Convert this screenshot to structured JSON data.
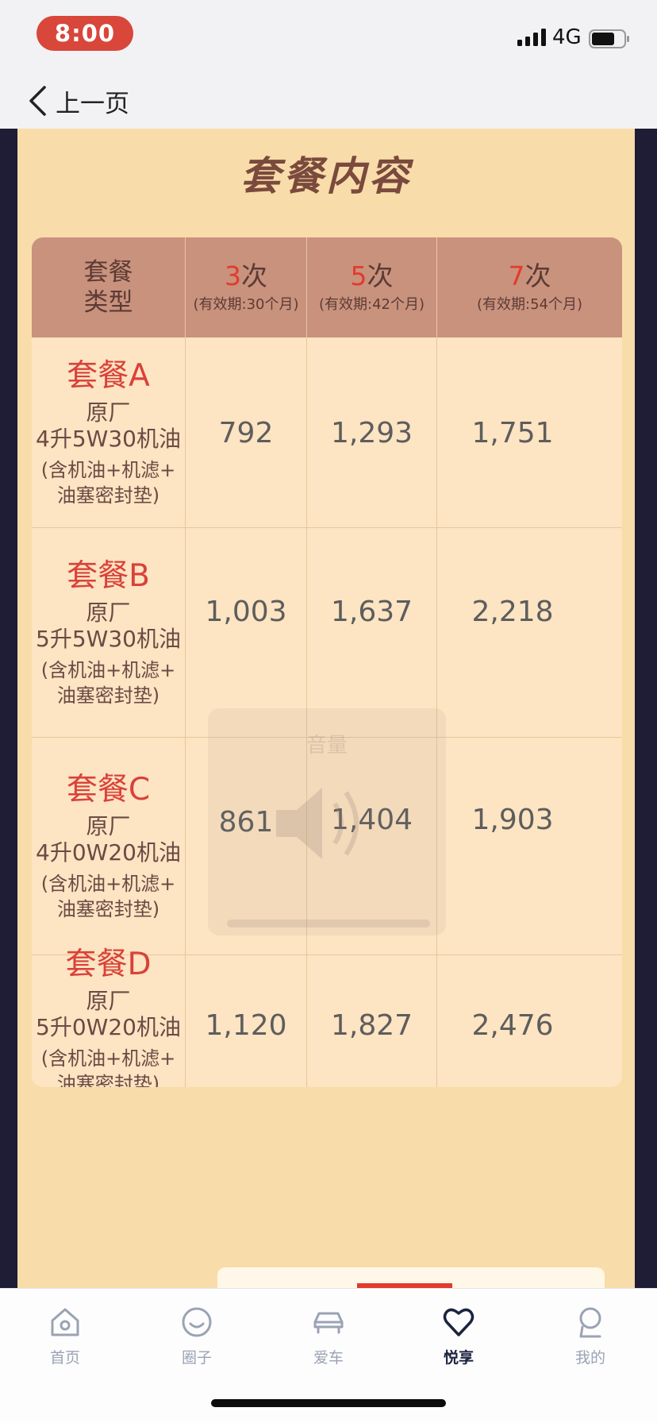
{
  "status_bar": {
    "time": "8:00",
    "network": "4G"
  },
  "nav": {
    "back_label": "上一页"
  },
  "section": {
    "title": "套餐内容"
  },
  "table": {
    "type_header": [
      "套餐",
      "类型"
    ],
    "columns": [
      {
        "count": "3",
        "unit": "次",
        "validity": "(有效期:30个月)"
      },
      {
        "count": "5",
        "unit": "次",
        "validity": "(有效期:42个月)"
      },
      {
        "count": "7",
        "unit": "次",
        "validity": "(有效期:54个月)"
      }
    ],
    "rows": [
      {
        "name": "套餐A",
        "origin": "原厂",
        "oil": "4升5W30机油",
        "note1": "(含机油+机滤+",
        "note2": "油塞密封垫)",
        "prices": [
          "792",
          "1,293",
          "1,751"
        ]
      },
      {
        "name": "套餐B",
        "origin": "原厂",
        "oil": "5升5W30机油",
        "note1": "(含机油+机滤+",
        "note2": "油塞密封垫)",
        "prices": [
          "1,003",
          "1,637",
          "2,218"
        ]
      },
      {
        "name": "套餐C",
        "origin": "原厂",
        "oil": "4升0W20机油",
        "note1": "(含机油+机滤+",
        "note2": "油塞密封垫)",
        "prices": [
          "861",
          "1,404",
          "1,903"
        ]
      },
      {
        "name": "套餐D",
        "origin": "原厂",
        "oil": "5升0W20机油",
        "note1": "(含机油+机滤+",
        "note2": "油塞密封垫)",
        "prices": [
          "1,120",
          "1,827",
          "2,476"
        ]
      }
    ]
  },
  "volume_overlay": {
    "title": "音量",
    "icon": "speaker-icon"
  },
  "tabs": [
    {
      "label": "首页",
      "icon": "home-icon",
      "active": false
    },
    {
      "label": "圈子",
      "icon": "smiley-icon",
      "active": false
    },
    {
      "label": "爱车",
      "icon": "car-icon",
      "active": false
    },
    {
      "label": "悦享",
      "icon": "heart-icon",
      "active": true
    },
    {
      "label": "我的",
      "icon": "user-icon",
      "active": false
    }
  ],
  "colors": {
    "accent": "#d9413a",
    "poster_bg": "#f8dcaa",
    "header_bg": "#c9927d",
    "dark_bg": "#1f1d35"
  }
}
